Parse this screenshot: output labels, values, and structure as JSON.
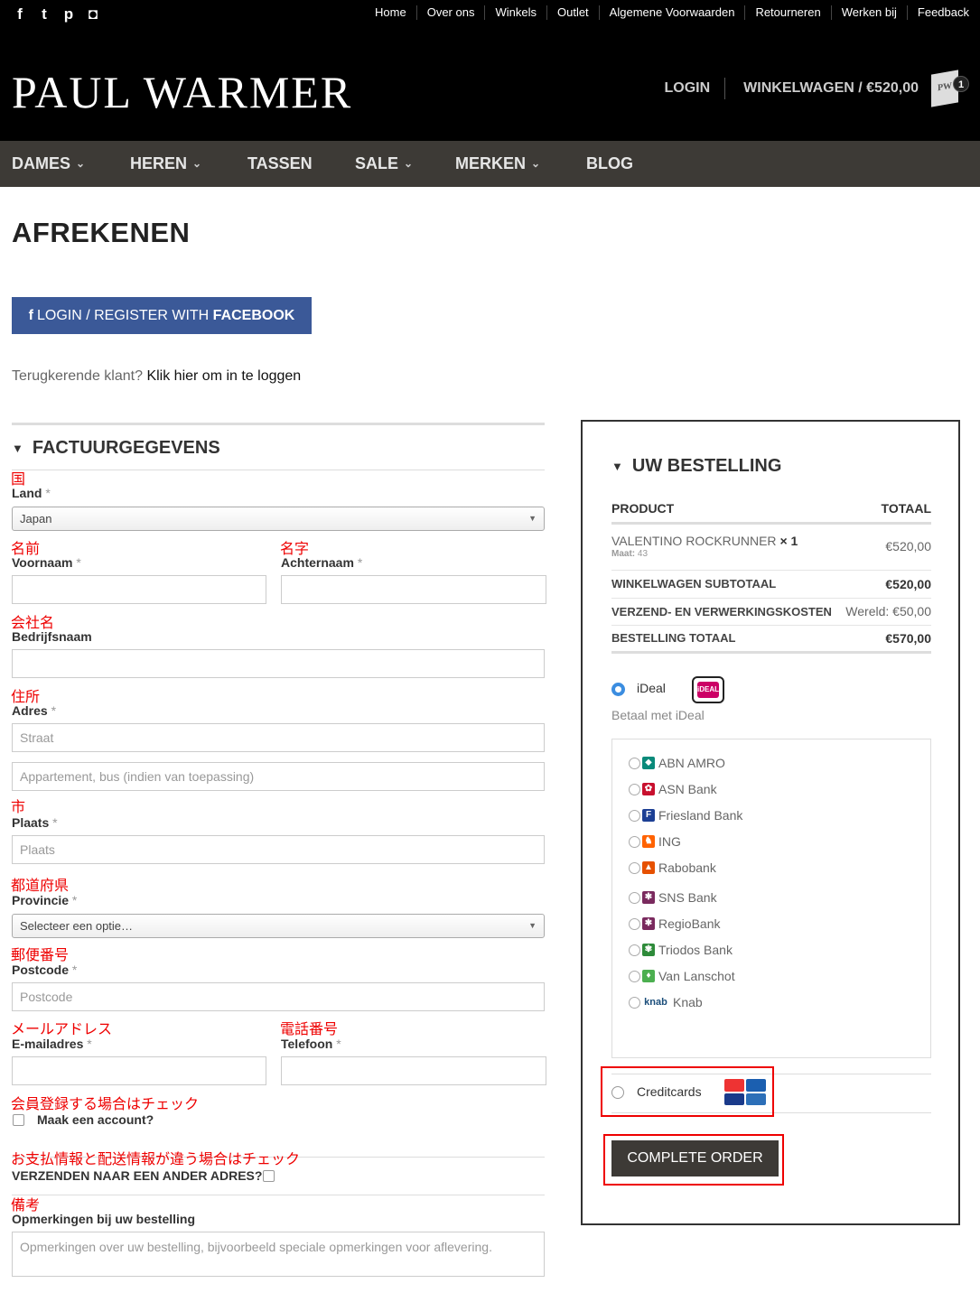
{
  "social": [
    {
      "icon": "facebook-icon",
      "glyph": "f"
    },
    {
      "icon": "twitter-icon",
      "glyph": "t"
    },
    {
      "icon": "pinterest-icon",
      "glyph": "p"
    },
    {
      "icon": "instagram-icon",
      "glyph": "◘"
    }
  ],
  "toplinks": [
    "Home",
    "Over ons",
    "Winkels",
    "Outlet",
    "Algemene Voorwaarden",
    "Retourneren",
    "Werken bij",
    "Feedback"
  ],
  "logo": "PAUL WARMER",
  "header": {
    "login": "LOGIN",
    "cart": "WINKELWAGEN / €520,00",
    "cart_count": "1",
    "cart_bag_text": "PW"
  },
  "nav": [
    {
      "label": "DAMES",
      "dd": true
    },
    {
      "label": "HEREN",
      "dd": true
    },
    {
      "label": "TASSEN",
      "dd": false
    },
    {
      "label": "SALE",
      "dd": true
    },
    {
      "label": "MERKEN",
      "dd": true
    },
    {
      "label": "BLOG",
      "dd": false
    }
  ],
  "page_title": "AFREKENEN",
  "fb": {
    "prefix": "LOGIN / REGISTER WITH ",
    "bold": "FACEBOOK"
  },
  "returning": {
    "text": "Terugkerende klant? ",
    "link": "Klik hier om in te loggen"
  },
  "billing": {
    "title": "FACTUURGEGEVENS",
    "land": {
      "jp": "国",
      "label": "Land",
      "value": "Japan"
    },
    "first": {
      "jp": "名前",
      "label": "Voornaam"
    },
    "last": {
      "jp": "名字",
      "label": "Achternaam"
    },
    "company": {
      "jp": "会社名",
      "label": "Bedrijfsnaam"
    },
    "address": {
      "jp": "住所",
      "label": "Adres",
      "ph1": "Straat",
      "ph2": "Appartement, bus (indien van toepassing)"
    },
    "city": {
      "jp": "市",
      "label": "Plaats",
      "ph": "Plaats"
    },
    "province": {
      "jp": "都道府県",
      "label": "Provincie",
      "value": "Selecteer een optie…"
    },
    "postcode": {
      "jp": "郵便番号",
      "label": "Postcode",
      "ph": "Postcode"
    },
    "email": {
      "jp": "メールアドレス",
      "label": "E-mailadres"
    },
    "phone": {
      "jp": "電話番号",
      "label": "Telefoon"
    },
    "account": {
      "jp": "会員登録する場合はチェック",
      "label": "Maak een account?"
    },
    "ship": {
      "jp": "お支払情報と配送情報が違う場合はチェック",
      "label": "VERZENDEN NAAR EEN ANDER ADRES?"
    },
    "notes": {
      "jp": "備考",
      "label": "Opmerkingen bij uw bestelling",
      "ph": "Opmerkingen over uw bestelling, bijvoorbeeld speciale opmerkingen voor aflevering."
    },
    "req": "*"
  },
  "order": {
    "title": "UW BESTELLING",
    "h_product": "PRODUCT",
    "h_total": "TOTAAL",
    "item": {
      "name": "VALENTINO ROCKRUNNER",
      "qty": "× 1",
      "size_label": "Maat:",
      "size": "43",
      "price": "€520,00"
    },
    "subtotal": {
      "label": "WINKELWAGEN SUBTOTAAL",
      "value": "€520,00"
    },
    "shipping": {
      "label": "VERZEND- EN VERWERKINGSKOSTEN",
      "value": "Wereld: €50,00"
    },
    "total": {
      "label": "BESTELLING TOTAAL",
      "value": "€570,00"
    },
    "ideal": {
      "label": "iDeal",
      "desc": "Betaal met iDeal",
      "logo": "iDEAL"
    },
    "banks": [
      {
        "name": "ABN AMRO",
        "icon": "abn-amro-icon",
        "color": "#0a8a7a",
        "g": "⬥"
      },
      {
        "name": "ASN Bank",
        "icon": "asn-bank-icon",
        "color": "#c8102e",
        "g": "✿"
      },
      {
        "name": "Friesland Bank",
        "icon": "friesland-bank-icon",
        "color": "#1c3f94",
        "g": "F"
      },
      {
        "name": "ING",
        "icon": "ing-icon",
        "color": "#ff6200",
        "g": "♞"
      },
      {
        "name": "Rabobank",
        "icon": "rabobank-icon",
        "color": "#e65100",
        "g": "▲"
      },
      {
        "name": "SNS Bank",
        "icon": "sns-bank-icon",
        "color": "#7a2a5e",
        "g": "✱"
      },
      {
        "name": "RegioBank",
        "icon": "regiobank-icon",
        "color": "#7a2a5e",
        "g": "✱"
      },
      {
        "name": "Triodos Bank",
        "icon": "triodos-bank-icon",
        "color": "#2e8b3a",
        "g": "✾"
      },
      {
        "name": "Van Lanschot",
        "icon": "van-lanschot-icon",
        "color": "#4caf50",
        "g": "♦"
      },
      {
        "name": "Knab",
        "icon": "knab-icon",
        "color": "#1a4d7a",
        "g": "knab"
      }
    ],
    "credit": {
      "label": "Creditcards",
      "cards": [
        "MasterCard",
        "Maestro",
        "VISA",
        "VISA Electron"
      ]
    },
    "button": "COMPLETE ORDER"
  }
}
